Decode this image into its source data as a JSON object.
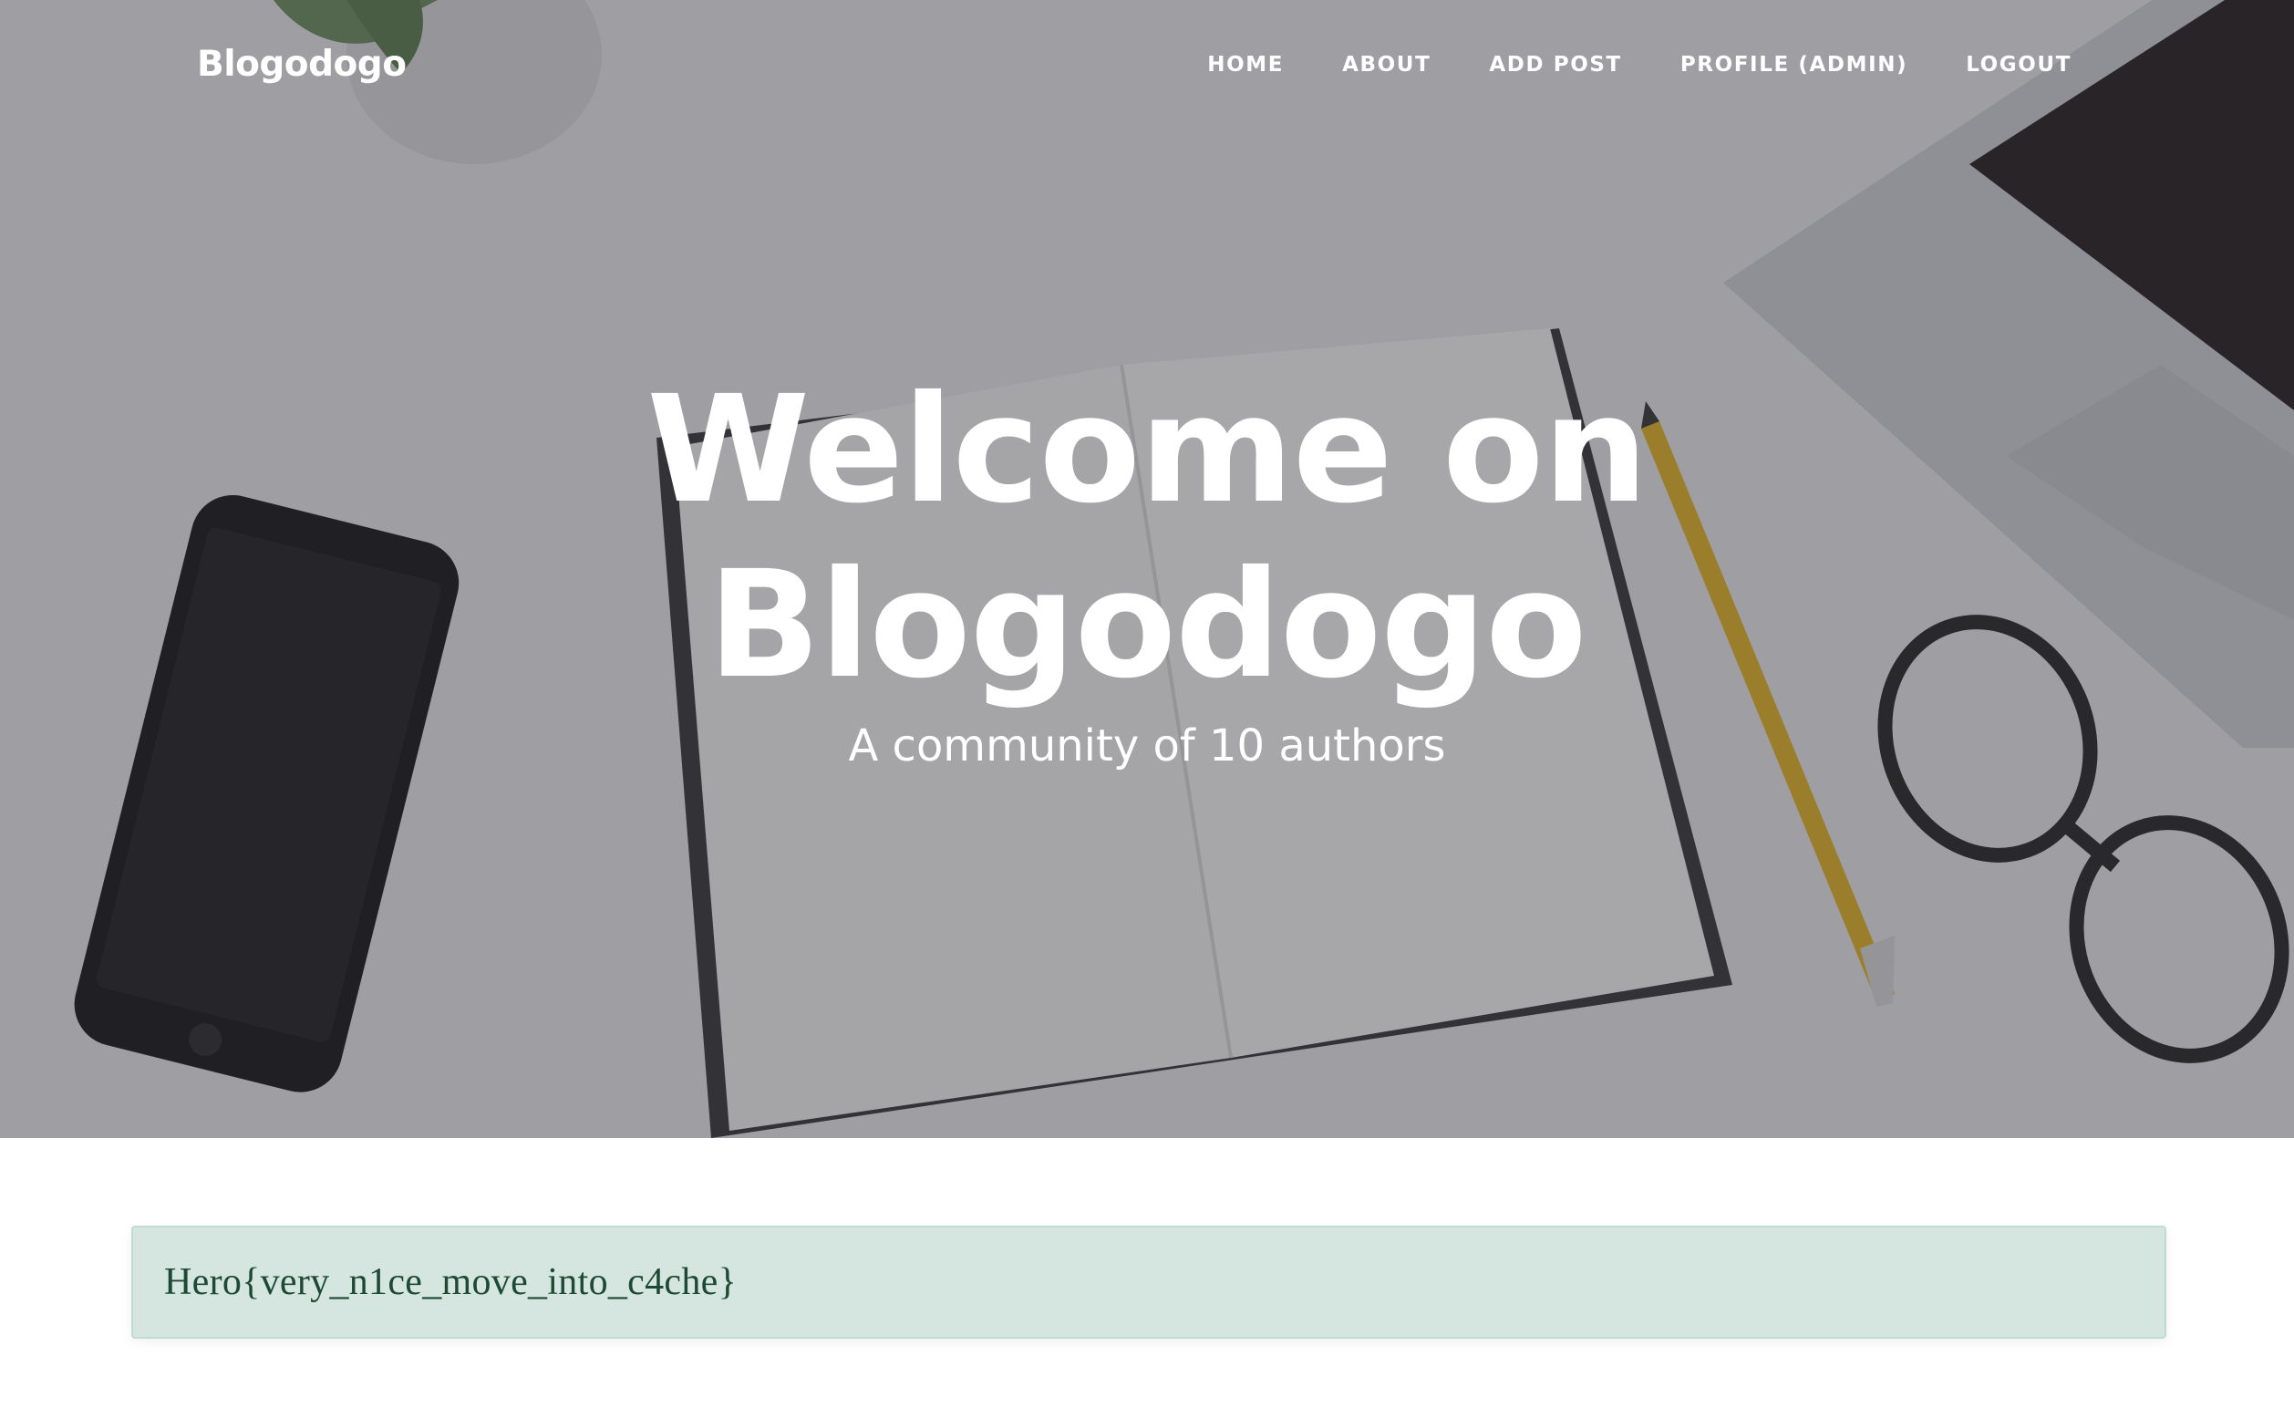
{
  "navbar": {
    "brand": "Blogodogo",
    "links": [
      "Home",
      "About",
      "Add Post",
      "Profile (admin)",
      "Logout"
    ]
  },
  "hero": {
    "heading_line1": "Welcome on",
    "heading_line2": "Blogodogo",
    "subheading": "A community of 10 authors"
  },
  "alert": {
    "message": "Hero{very_n1ce_move_into_c4che}"
  },
  "colors": {
    "alert_background": "#d4e6df",
    "alert_text": "#1e4a35",
    "hero_text": "#ffffff"
  }
}
